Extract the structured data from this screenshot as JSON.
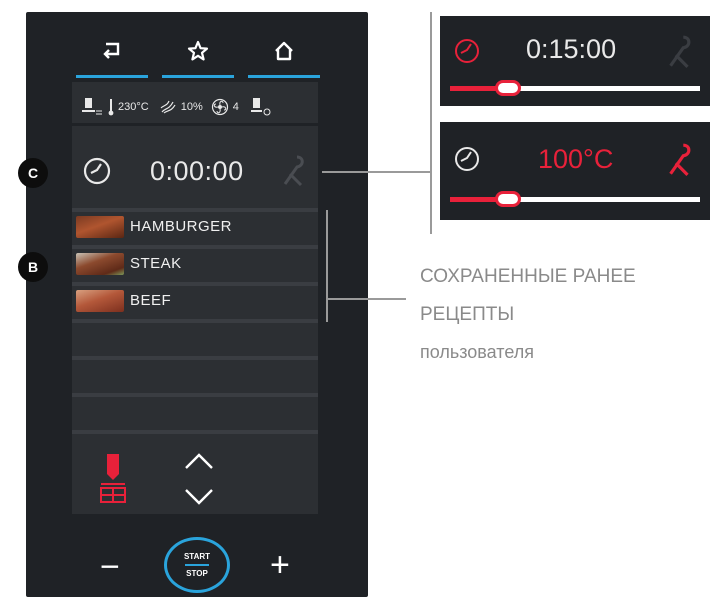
{
  "nav": {
    "back_icon": "back-arrow-icon",
    "favorites_icon": "star-icon",
    "home_icon": "home-icon",
    "accent_color": "#2aa4dc"
  },
  "status": {
    "temperature": "230°C",
    "humidity": "10%",
    "fan_speed": "4"
  },
  "timer": {
    "value": "0:00:00",
    "badge": "C"
  },
  "recipes": {
    "badge": "B",
    "items": [
      {
        "label": "HAMBURGER"
      },
      {
        "label": "STEAK"
      },
      {
        "label": "BEEF"
      }
    ]
  },
  "controls": {
    "minus": "−",
    "plus": "+",
    "start": "START",
    "stop": "STOP"
  },
  "callout_top": {
    "time": "0:15:00",
    "slider_level": 0.23
  },
  "callout_bottom": {
    "temperature": "100°C",
    "temperature_color": "#e8213a",
    "slider_level": 0.23
  },
  "annotation": {
    "line1": "СОХРАНЕННЫЕ РАНЕЕ",
    "line2": "РЕЦЕПТЫ",
    "line3": "пользователя"
  }
}
